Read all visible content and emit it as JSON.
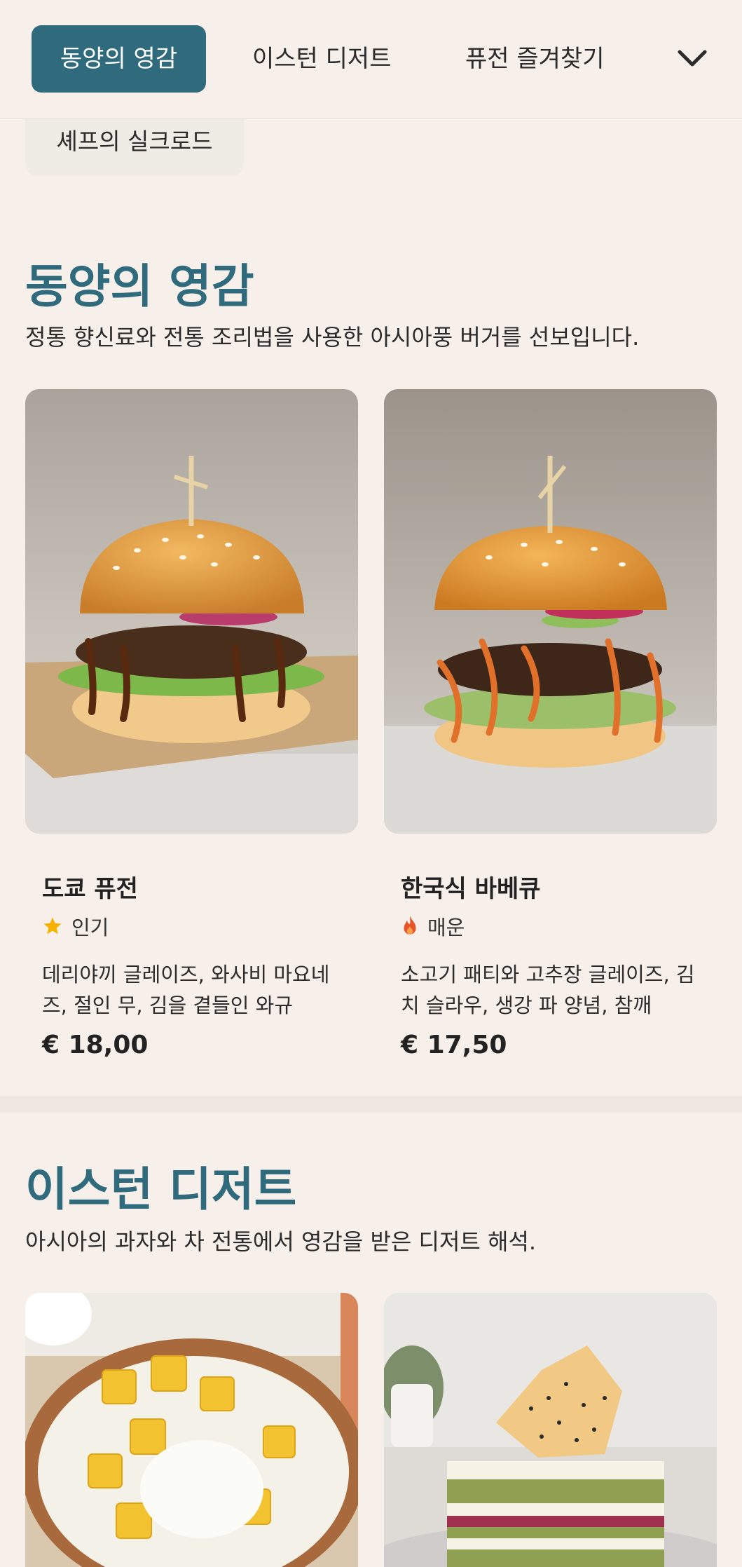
{
  "nav": {
    "tabs": [
      {
        "label": "동양의 영감",
        "active": true
      },
      {
        "label": "이스턴 디저트",
        "active": false
      },
      {
        "label": "퓨전 즐겨찾기",
        "active": false
      }
    ],
    "more_icon": "chevron-down-icon",
    "overflow_tab": {
      "label": "셰프의 실크로드"
    }
  },
  "sections": [
    {
      "title": "동양의 영감",
      "description": "정통 향신료와 전통 조리법을 사용한 아시아풍 버거를 선보입니다.",
      "items": [
        {
          "name": "도쿄 퓨전",
          "tag": "인기",
          "tag_icon": "star-icon",
          "description": "데리야끼 글레이즈, 와사비 마요네즈, 절인 무, 김을 곁들인 와규 패...",
          "price": "€ 18,00",
          "image": "burger-teriyaki-image"
        },
        {
          "name": "한국식 바베큐",
          "tag": "매운",
          "tag_icon": "flame-icon",
          "description": "소고기 패티와 고추장 글레이즈, 김치 슬라우, 생강 파 양념, 참깨 마...",
          "price": "€ 17,50",
          "image": "burger-korean-bbq-image"
        }
      ]
    },
    {
      "title": "이스턴 디저트",
      "description": "아시아의 과자와 차 전통에서 영감을 받은 디저트 해석.",
      "items": [
        {
          "image": "mango-sticky-rice-image"
        },
        {
          "image": "matcha-cake-image"
        }
      ]
    }
  ],
  "colors": {
    "accent": "#2f6b7d",
    "background": "#f7efea",
    "star": "#f5b300",
    "flame": "#e8542a"
  }
}
